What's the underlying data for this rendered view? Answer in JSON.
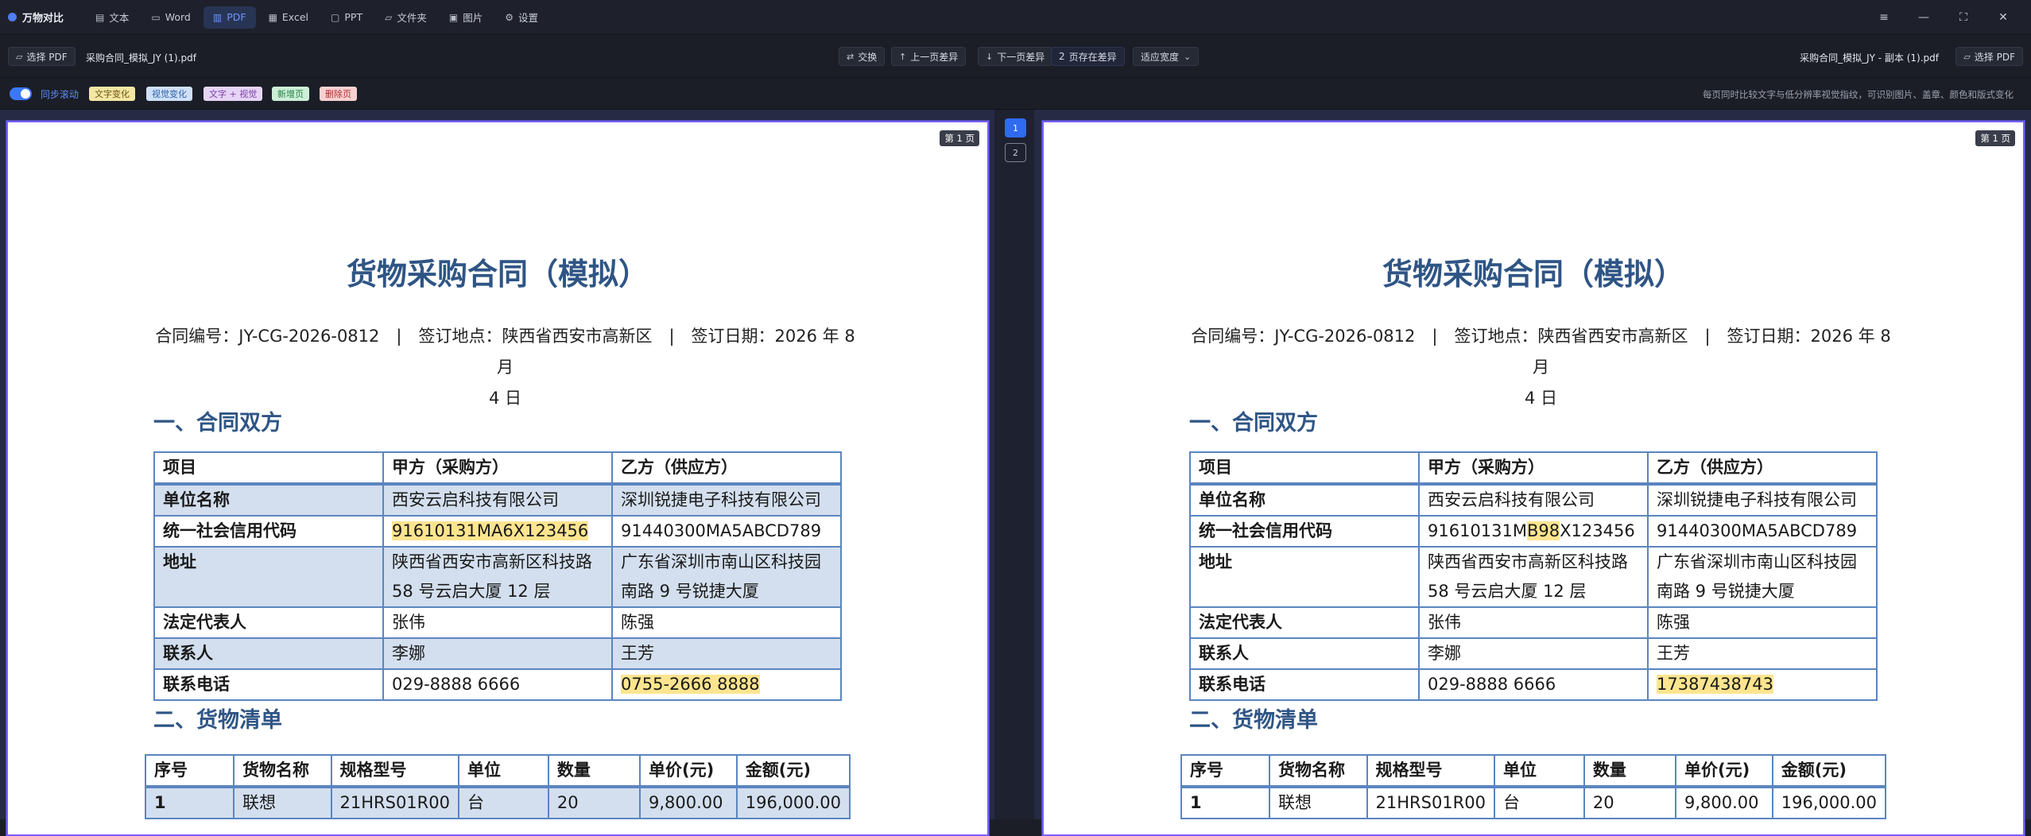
{
  "app": {
    "title": "万物对比"
  },
  "nav": {
    "tabs": [
      {
        "label": "文本",
        "icon": "document-icon"
      },
      {
        "label": "Word",
        "icon": "word-icon"
      },
      {
        "label": "PDF",
        "icon": "pdf-icon"
      },
      {
        "label": "Excel",
        "icon": "table-icon"
      },
      {
        "label": "PPT",
        "icon": "slides-icon"
      },
      {
        "label": "文件夹",
        "icon": "folder-icon"
      },
      {
        "label": "图片",
        "icon": "image-icon"
      },
      {
        "label": "设置",
        "icon": "gear-icon"
      }
    ],
    "active": "PDF"
  },
  "window": {
    "settings_icon": "≡",
    "min": "—",
    "max": "⛶",
    "close": "✕"
  },
  "toolbar": {
    "select_left": "选择 PDF",
    "left_file": "采购合同_模拟_JY (1).pdf",
    "swap": "交换",
    "prev_diff": "上一页差异",
    "next_diff": "下一页差异",
    "diff_count": "2",
    "diff_label": "页存在差异",
    "fit": "适应宽度",
    "right_file": "采购合同_模拟_JY - 副本 (1).pdf",
    "select_right": "选择 PDF"
  },
  "filters": {
    "sync_scroll": "同步滚动",
    "tags": [
      {
        "label": "文字变化",
        "bg": "#f3e7a4",
        "fg": "#6b5410"
      },
      {
        "label": "视觉变化",
        "bg": "#cfe0f8",
        "fg": "#2d5fa6"
      },
      {
        "label": "文字 + 视觉",
        "bg": "#e6d4f5",
        "fg": "#7b3fa8"
      },
      {
        "label": "新增页",
        "bg": "#cdeed7",
        "fg": "#27814a"
      },
      {
        "label": "删除页",
        "bg": "#f7d1d1",
        "fg": "#b02e2e"
      }
    ],
    "hint": "每页同时比较文字与低分辨率视觉指纹，可识别图片、盖章、颜色和版式变化"
  },
  "pages": {
    "badge": "第 1 页",
    "nav": [
      "1",
      "2"
    ]
  },
  "doc": {
    "title": "货物采购合同（模拟）",
    "meta_line1": "合同编号：JY-CG-2026-0812　|　签订地点：陕西省西安市高新区　|　签订日期：2026 年 8 月",
    "meta_line2": "4 日",
    "section1": "一、合同双方",
    "section2": "二、货物清单",
    "parties_header": [
      "项目",
      "甲方（采购方）",
      "乙方（供应方）"
    ],
    "parties": {
      "r1": [
        "单位名称",
        "西安云启科技有限公司",
        "深圳锐捷电子科技有限公司"
      ],
      "r2_label": "统一社会信用代码",
      "r2_right": "91440300MA5ABCD789",
      "r3": [
        "地址",
        "陕西省西安市高新区科技路",
        "58 号云启大厦 12 层",
        "广东省深圳市南山区科技园",
        "南路 9 号锐捷大厦"
      ],
      "r4": [
        "法定代表人",
        "张伟",
        "陈强"
      ],
      "r5": [
        "联系人",
        "李娜",
        "王芳"
      ],
      "r6_label": "联系电话",
      "r6_mid": "029-8888 6666"
    },
    "left_diff": {
      "credit_code": "91610131MA6X123456",
      "phone": "0755-2666 8888"
    },
    "right_diff": {
      "credit_pre": "91610131M",
      "credit_hl": "B98",
      "credit_post": "X123456",
      "phone": "17387438743"
    },
    "goods_header": [
      "序号",
      "货物名称",
      "规格型号",
      "单位",
      "数量",
      "单价(元)",
      "金额(元)"
    ],
    "goods_row1": [
      "1",
      "联想",
      "21HRS01R00",
      "台",
      "20",
      "9,800.00",
      "196,000.00"
    ]
  }
}
